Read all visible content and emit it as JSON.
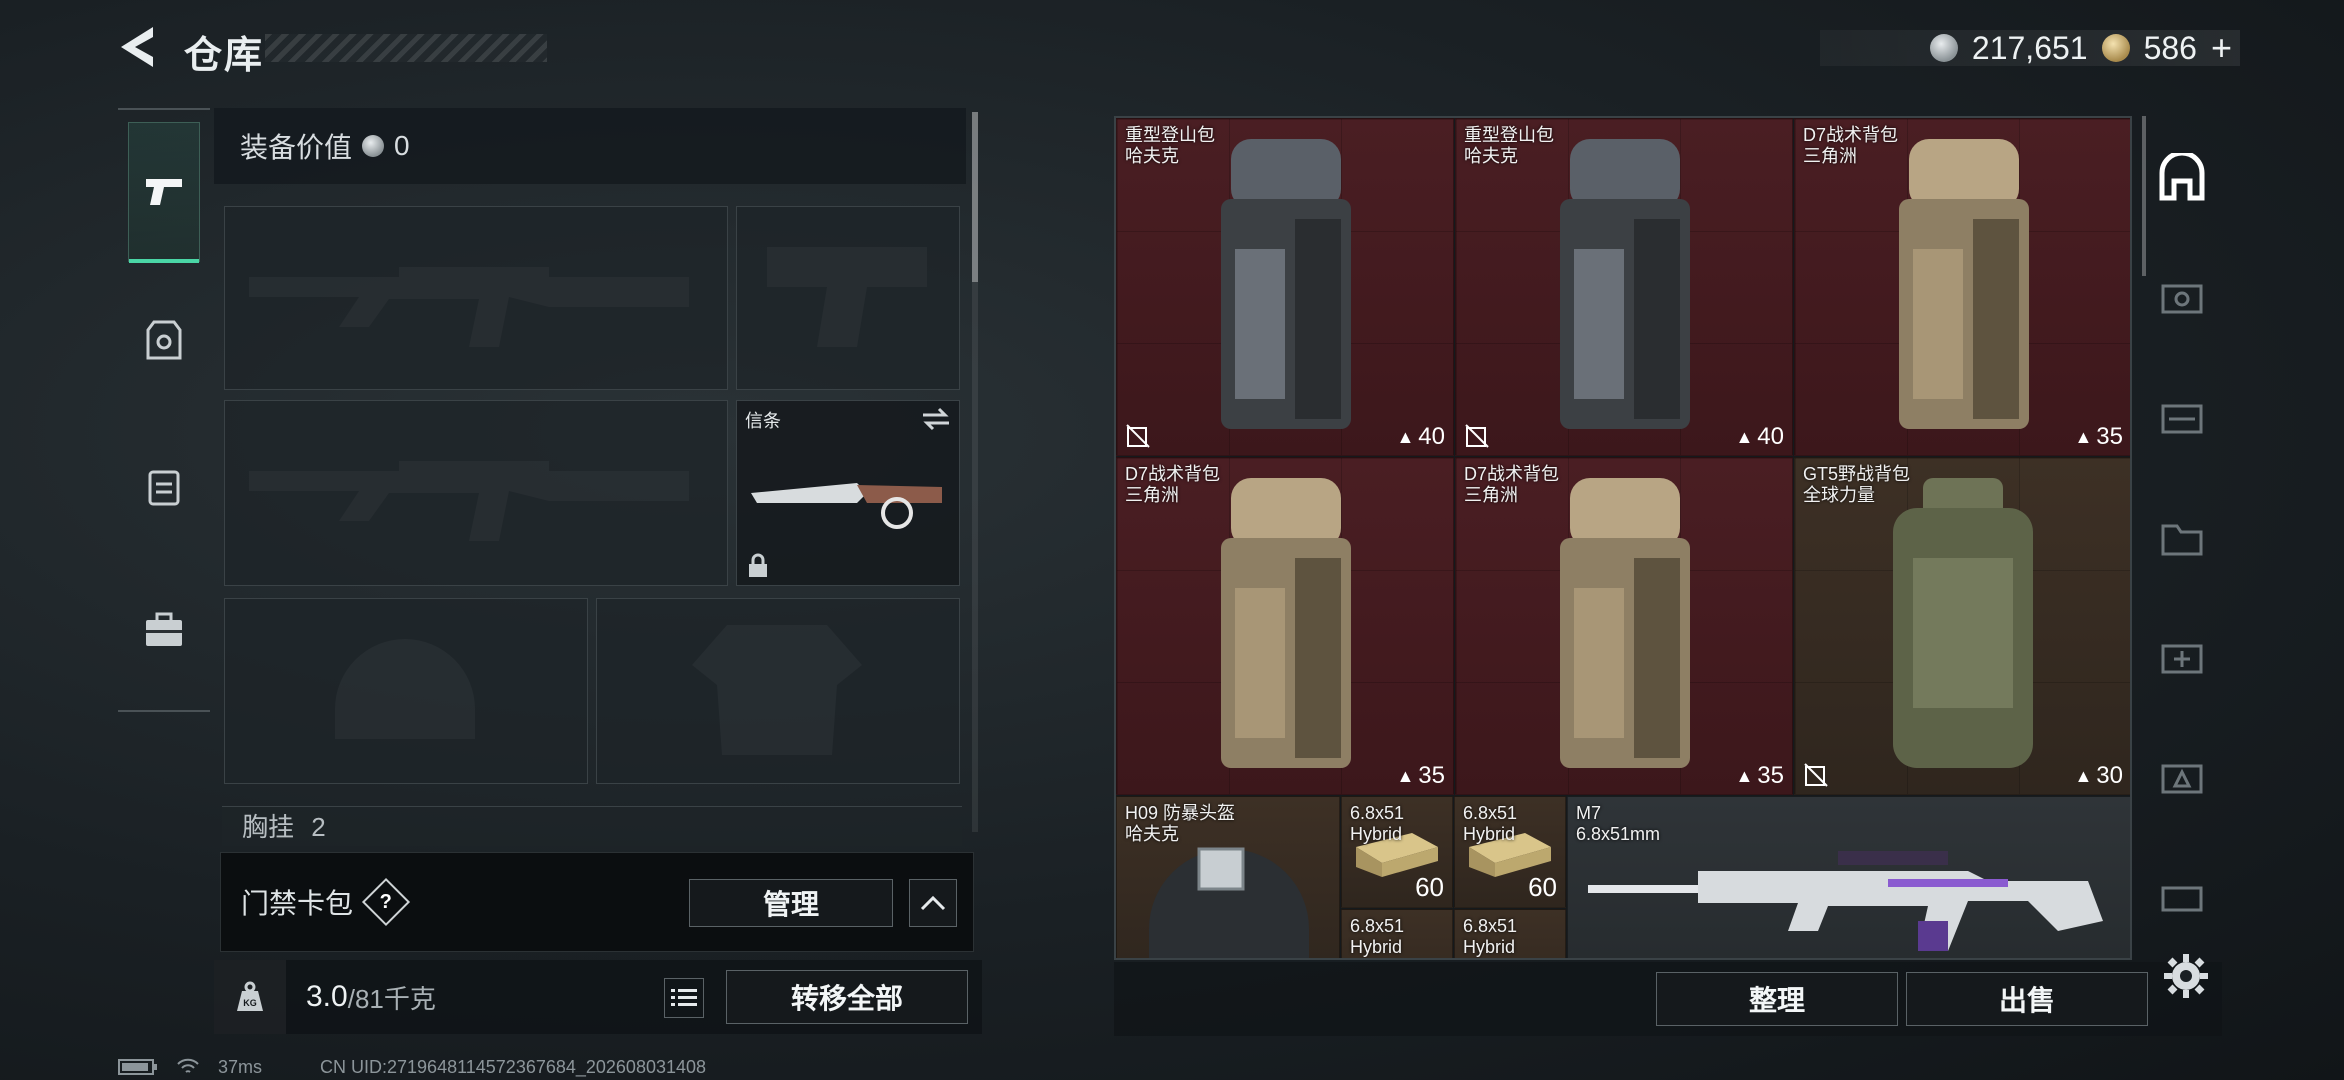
{
  "header": {
    "title": "仓库",
    "currency_primary": "217,651",
    "currency_secondary": "586",
    "plus_label": "+"
  },
  "equipment": {
    "value_label": "装备价值",
    "value": "0",
    "melee_slot_label": "信条",
    "chest_rig_label": "胸挂",
    "chest_rig_count": "2"
  },
  "keycard": {
    "label": "门禁卡包",
    "help": "?",
    "manage_button": "管理"
  },
  "weight": {
    "icon_text": "KG",
    "current": "3.0",
    "max": "/81千克",
    "transfer_button": "转移全部"
  },
  "storage_items": [
    {
      "name": "重型登山包",
      "brand": "哈夫克",
      "capacity": "40"
    },
    {
      "name": "重型登山包",
      "brand": "哈夫克",
      "capacity": "40"
    },
    {
      "name": "D7战术背包",
      "brand": "三角洲",
      "capacity": "35"
    },
    {
      "name": "D7战术背包",
      "brand": "三角洲",
      "capacity": "35"
    },
    {
      "name": "D7战术背包",
      "brand": "三角洲",
      "capacity": "35"
    },
    {
      "name": "GT5野战背包",
      "brand": "全球力量",
      "capacity": "30"
    },
    {
      "name": "H09 防暴头盔",
      "brand": "哈夫克"
    },
    {
      "name": "6.8x51",
      "brand": "Hybrid",
      "count": "60"
    },
    {
      "name": "6.8x51",
      "brand": "Hybrid",
      "count": "60"
    },
    {
      "name": "6.8x51",
      "brand": "Hybrid"
    },
    {
      "name": "6.8x51",
      "brand": "Hybrid"
    },
    {
      "name": "M7",
      "brand": "6.8x51mm"
    }
  ],
  "actions": {
    "sort_button": "整理",
    "sell_button": "出售"
  },
  "status": {
    "ping": "37ms",
    "uid": "CN UID:2719648114572367684_202608031408"
  },
  "colors": {
    "accent": "#4ad6a6",
    "rare_red": "#4a1e23",
    "common_brown": "#3d3025"
  }
}
